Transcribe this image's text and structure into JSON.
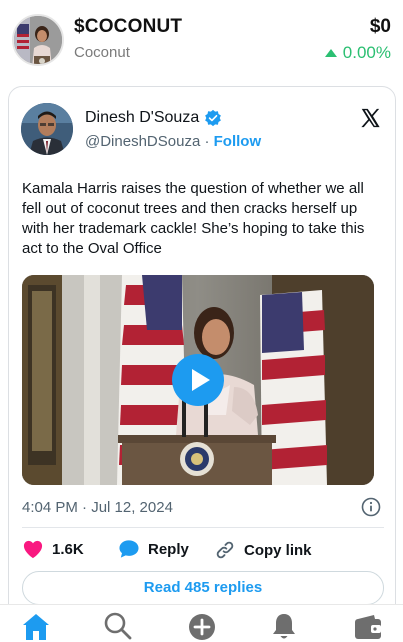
{
  "token": {
    "ticker": "$COCONUT",
    "name": "Coconut",
    "price": "$0",
    "change": "0.00%",
    "change_color": "#2bbf72"
  },
  "tweet": {
    "author_name": "Dinesh D'Souza",
    "author_handle": "@DineshDSouza",
    "separator": " · ",
    "follow_label": "Follow",
    "text": "Kamala Harris raises the question of whether we all fell out of coconut trees and then cracks herself up with her trademark cackle! She’s hoping to take this act to the Oval Office",
    "timestamp": "4:04 PM · Jul 12, 2024",
    "likes": "1.6K",
    "reply_label": "Reply",
    "copy_link_label": "Copy link",
    "read_replies_label": "Read 485 replies"
  },
  "icons": {
    "verified": "verified-badge-icon",
    "x_logo": "x-logo-icon",
    "play": "play-icon",
    "info": "info-icon",
    "like": "heart-icon",
    "reply": "speech-bubble-icon",
    "copy_link": "link-icon",
    "nav": [
      "home-icon",
      "search-icon",
      "plus-circle-icon",
      "bell-icon",
      "wallet-icon"
    ]
  },
  "colors": {
    "accent_blue": "#1d9bf0",
    "like_pink": "#f91880",
    "text_primary": "#0f1419",
    "text_secondary": "#536471"
  }
}
